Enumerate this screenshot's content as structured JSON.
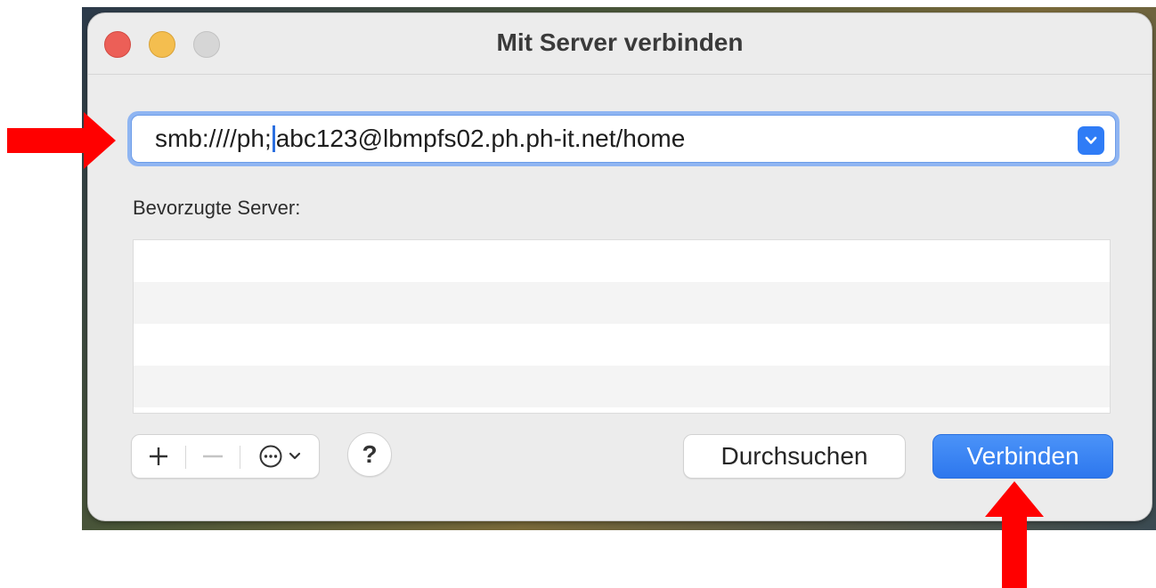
{
  "window": {
    "title": "Mit Server verbinden",
    "traffic_lights": [
      "close",
      "minimize",
      "zoom"
    ]
  },
  "address": {
    "value_before_caret": "smb:////ph;",
    "value_after_caret": "abc123@lbmpfs02.ph.ph-it.net/home",
    "dropdown_icon": "chevron-down-icon"
  },
  "favorites": {
    "label": "Bevorzugte Server:",
    "items": []
  },
  "toolbar": {
    "add_label": "+",
    "remove_label": "—",
    "more_icon": "ellipsis-circle-icon",
    "help_label": "?"
  },
  "buttons": {
    "browse_label": "Durchsuchen",
    "connect_label": "Verbinden"
  },
  "colors": {
    "accent": "#2f7cf6",
    "annotation_arrow": "#ff0000"
  }
}
